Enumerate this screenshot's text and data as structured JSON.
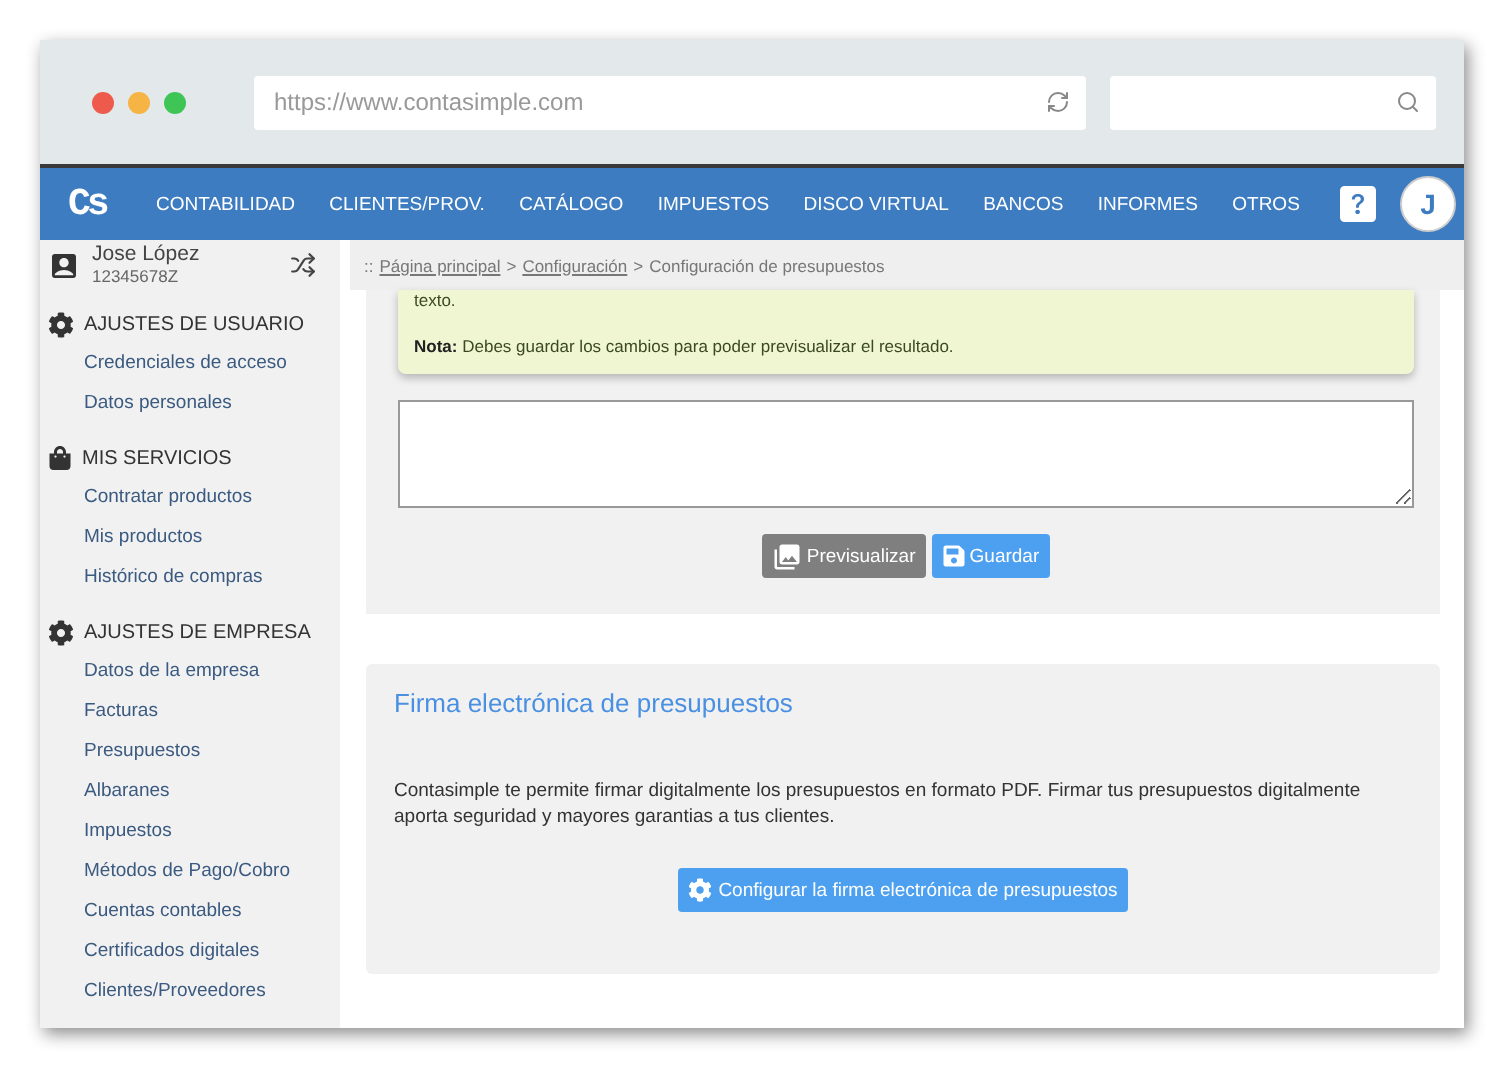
{
  "browser": {
    "url": "https://www.contasimple.com"
  },
  "navbar": {
    "logo": "Cs",
    "items": [
      "CONTABILIDAD",
      "CLIENTES/PROV.",
      "CATÁLOGO",
      "IMPUESTOS",
      "DISCO VIRTUAL",
      "BANCOS",
      "INFORMES",
      "OTROS"
    ],
    "avatar": "J"
  },
  "user": {
    "name": "Jose López",
    "id": "12345678Z"
  },
  "sidebar": {
    "sections": [
      {
        "title": "AJUSTES DE USUARIO",
        "kind": "gear",
        "items": [
          "Credenciales de acceso",
          "Datos personales"
        ]
      },
      {
        "title": "MIS SERVICIOS",
        "kind": "bag",
        "items": [
          "Contratar productos",
          "Mis productos",
          "Histórico de compras"
        ]
      },
      {
        "title": "AJUSTES DE EMPRESA",
        "kind": "gear",
        "items": [
          "Datos de la empresa",
          "Facturas",
          "Presupuestos",
          "Albaranes",
          "Impuestos",
          "Métodos de Pago/Cobro",
          "Cuentas contables",
          "Certificados digitales",
          "Clientes/Proveedores"
        ]
      }
    ]
  },
  "breadcrumb": {
    "prefix": "::",
    "separator": ">",
    "items": [
      {
        "label": "Página principal",
        "link": true
      },
      {
        "label": "Configuración",
        "link": true
      },
      {
        "label": "Configuración de presupuestos",
        "link": false
      }
    ]
  },
  "note": {
    "lines": [
      "texto.",
      "**Nota:** Debes guardar los cambios para poder previsualizar el resultado."
    ]
  },
  "editor": {
    "buttons": [
      {
        "label": "Previsualizar",
        "kind": "preview"
      },
      {
        "label": "Guardar",
        "kind": "save"
      }
    ]
  },
  "signature": {
    "title": "Firma electrónica de presupuestos",
    "text": "Contasimple te permite firmar digitalmente los presupuestos en formato PDF. Firmar tus presupuestos digitalmente aporta seguridad y mayores garantias a tus clientes.",
    "button": "Configurar la firma electrónica de presupuestos"
  }
}
